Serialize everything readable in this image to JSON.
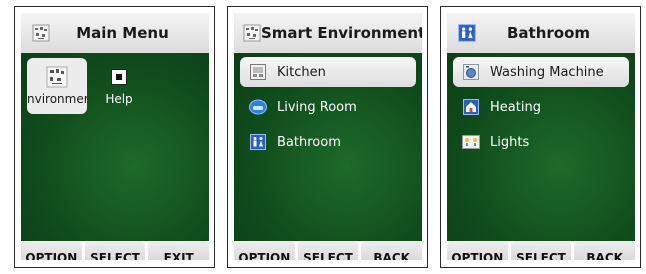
{
  "screens": [
    {
      "title": "Main Menu",
      "header_icon": "smart-environment-icon",
      "grid": [
        {
          "label": "nvironmer",
          "icon": "smart-environment-icon",
          "selected": true
        },
        {
          "label": "Help",
          "icon": "help-icon",
          "selected": false
        }
      ],
      "softkeys": [
        "OPTION",
        "SELECT",
        "EXIT"
      ]
    },
    {
      "title": "Smart Environment",
      "header_icon": "smart-environment-icon",
      "items": [
        {
          "label": "Kitchen",
          "icon": "kitchen-icon",
          "selected": true
        },
        {
          "label": "Living Room",
          "icon": "living-room-icon",
          "selected": false
        },
        {
          "label": "Bathroom",
          "icon": "bathroom-icon",
          "selected": false
        }
      ],
      "softkeys": [
        "OPTION",
        "SELECT",
        "BACK"
      ]
    },
    {
      "title": "Bathroom",
      "header_icon": "bathroom-icon",
      "items": [
        {
          "label": "Washing Machine",
          "icon": "washing-machine-icon",
          "selected": true
        },
        {
          "label": "Heating",
          "icon": "heating-icon",
          "selected": false
        },
        {
          "label": "Lights",
          "icon": "lights-icon",
          "selected": false
        }
      ],
      "softkeys": [
        "OPTION",
        "SELECT",
        "BACK"
      ]
    }
  ],
  "colors": {
    "content_bg": "#0f4a1b",
    "softkey_bg": "#dcdcdc",
    "selection_bg": "#ececec"
  }
}
